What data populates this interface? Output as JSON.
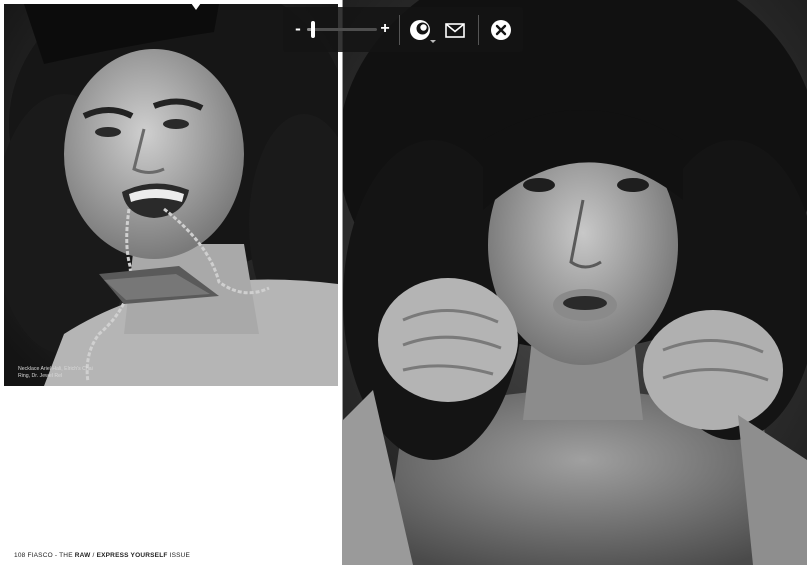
{
  "left_page": {
    "caption_line1": "Necklace Ariel Hali, Elrich's Chai",
    "caption_line2": "Ring, Dr. Jewel Rel",
    "folio_number": "108",
    "folio_mag": "FIASCO - THE",
    "folio_raw": "RAW",
    "folio_sep": "/",
    "folio_issue_name": "EXPRESS YOURSELF",
    "folio_issue": "ISSUE"
  },
  "toolbar": {
    "zoom_out_label": "-",
    "zoom_in_label": "+",
    "zoom_level": 0.08,
    "icons": [
      "zoom-out-icon",
      "zoom-in-icon",
      "share-icon",
      "mail-icon",
      "close-icon"
    ]
  },
  "colors": {
    "toolbar_bg": "#141414",
    "icon": "#ffffff",
    "page_bg": "#ffffff"
  }
}
